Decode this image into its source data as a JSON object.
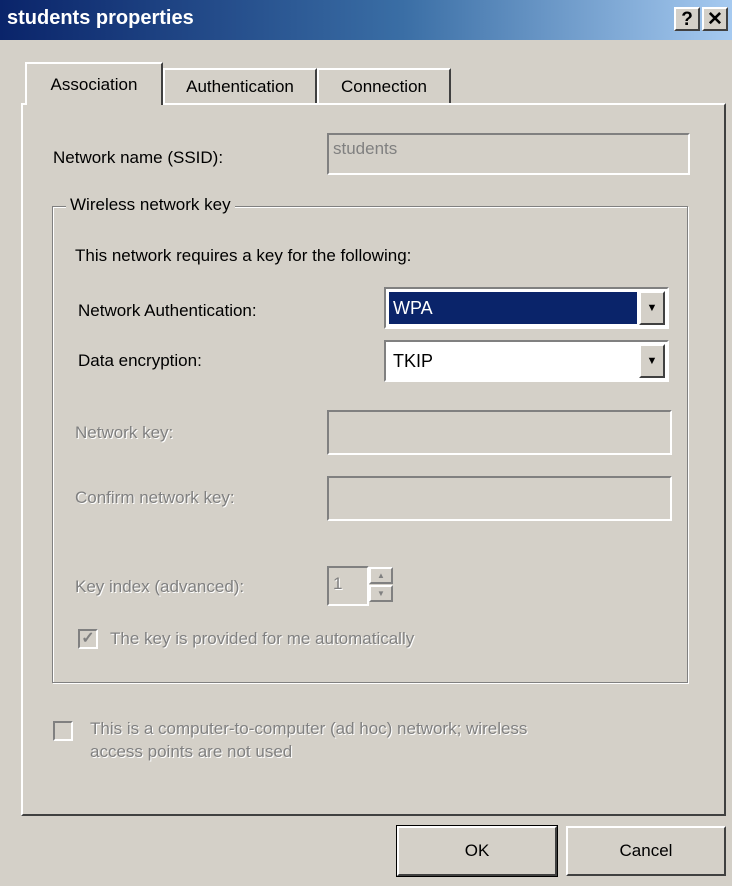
{
  "window": {
    "title": "students properties",
    "help_glyph": "?",
    "close_glyph": "✕"
  },
  "tabs": [
    {
      "label": "Association",
      "active": true
    },
    {
      "label": "Authentication",
      "active": false
    },
    {
      "label": "Connection",
      "active": false
    }
  ],
  "association": {
    "ssid_label": "Network name (SSID):",
    "ssid_value": "students",
    "group_title": "Wireless network key",
    "requires_text": "This network requires a key for the following:",
    "auth_label": "Network Authentication:",
    "auth_value": "WPA",
    "encryption_label": "Data encryption:",
    "encryption_value": "TKIP",
    "network_key_label": "Network key:",
    "network_key_value": "",
    "confirm_key_label": "Confirm network key:",
    "confirm_key_value": "",
    "key_index_label": "Key index (advanced):",
    "key_index_value": "1",
    "auto_key_label": "The key is provided for me automatically",
    "auto_key_checked": true,
    "adhoc_label_line1": "This is a computer-to-computer (ad hoc) network; wireless",
    "adhoc_label_line2": "access points are not used",
    "adhoc_checked": false
  },
  "buttons": {
    "ok": "OK",
    "cancel": "Cancel"
  },
  "colors": {
    "face": "#d4d0c8",
    "title_start": "#0a246a",
    "title_end": "#a6caf0",
    "selection": "#0a246a",
    "disabled_text": "#808080"
  },
  "icons": {
    "dropdown": "chevron-down-icon",
    "checkmark": "checkmark-icon",
    "spin_up": "arrow-up-icon",
    "spin_down": "arrow-down-icon"
  }
}
